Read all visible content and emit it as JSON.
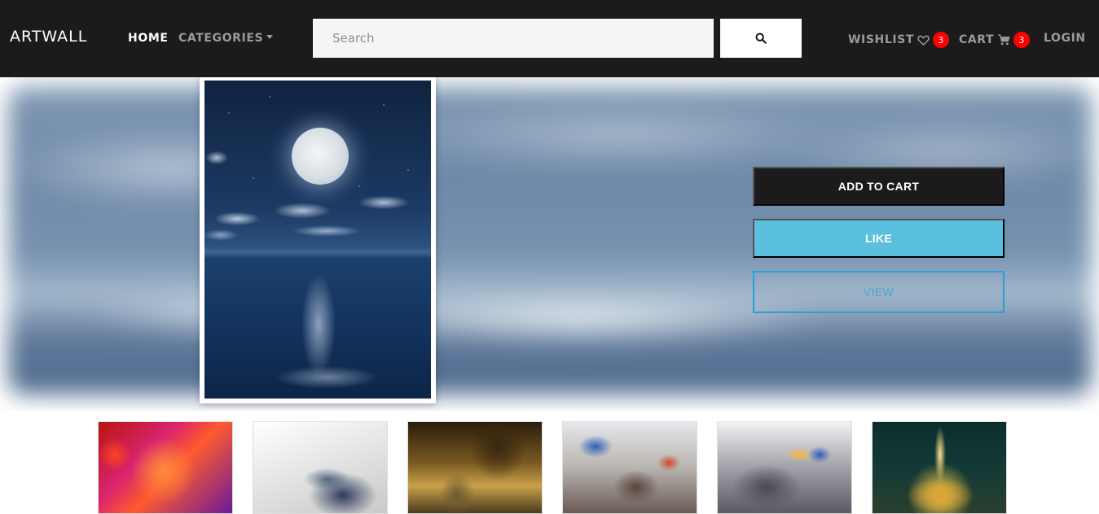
{
  "header": {
    "brand": "ARTWALL",
    "nav": {
      "home": "HOME",
      "categories": "CATEGORIES"
    },
    "search": {
      "placeholder": "Search",
      "value": ""
    },
    "wishlist": {
      "label": "WISHLIST",
      "count": "3"
    },
    "cart": {
      "label": "CART",
      "count": "3"
    },
    "login": "LOGIN"
  },
  "hero": {
    "actions": {
      "add_to_cart": "ADD TO CART",
      "like": "LIKE",
      "view": "VIEW"
    }
  },
  "colors": {
    "navbar": "#1b1b1b",
    "badge": "#ff0000",
    "like_button": "#5bc0de",
    "view_border": "#2b9fd6"
  },
  "icons": [
    "search-icon",
    "heart-icon",
    "cart-icon",
    "caret-down-icon"
  ]
}
